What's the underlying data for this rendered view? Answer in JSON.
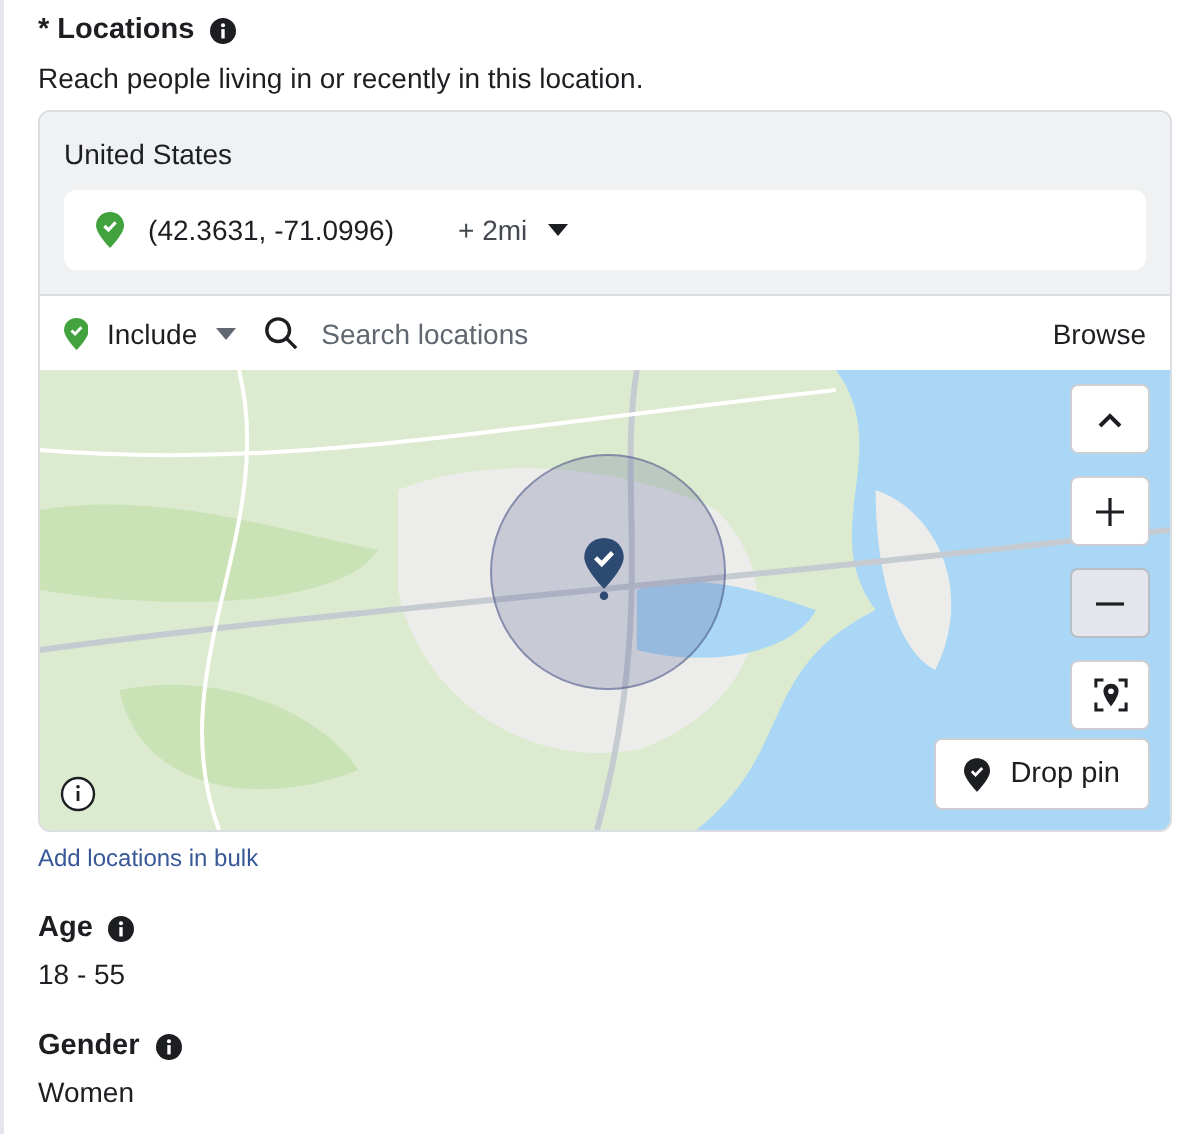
{
  "locations": {
    "title": "* Locations",
    "description": "Reach people living in or recently in this location.",
    "country": "United States",
    "selected_location": {
      "coordinates": "(42.3631, -71.0996)",
      "radius": "+ 2mi"
    },
    "filter": "Include",
    "search": {
      "placeholder": "Search locations"
    },
    "browse": "Browse",
    "map": {
      "controls": [
        {
          "kind": "collapse",
          "selected": false
        },
        {
          "kind": "zoom_in",
          "selected": false
        },
        {
          "kind": "zoom_out",
          "selected": true
        },
        {
          "kind": "locate",
          "selected": false
        }
      ],
      "drop_pin": "Drop pin"
    },
    "bulk_link": "Add locations in bulk"
  },
  "age": {
    "title": "Age",
    "value": "18 - 55"
  },
  "gender": {
    "title": "Gender",
    "value": "Women"
  }
}
